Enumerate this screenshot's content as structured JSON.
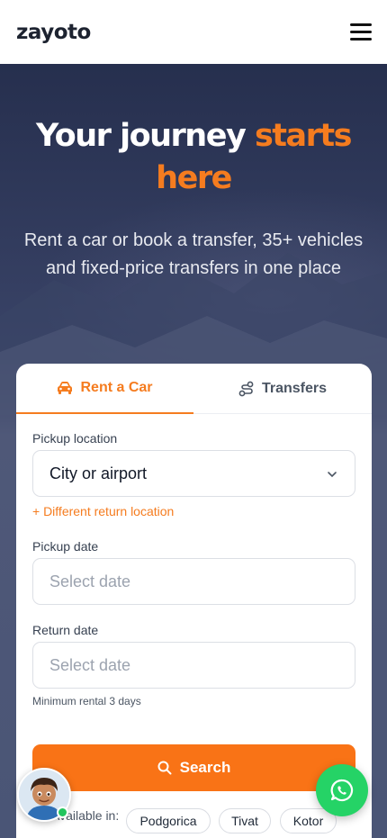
{
  "header": {
    "logo": "zayoto",
    "menu_icon": "hamburger-menu-icon"
  },
  "hero": {
    "title_main": "Your journey ",
    "title_accent": "starts here",
    "subtitle": "Rent a car or book a transfer, 35+ vehicles and fixed-price transfers in one place"
  },
  "booking": {
    "tabs": [
      {
        "label": "Rent a Car",
        "icon": "car-icon",
        "active": true
      },
      {
        "label": "Transfers",
        "icon": "route-icon",
        "active": false
      }
    ],
    "pickup_location": {
      "label": "Pickup location",
      "value": "City or airport"
    },
    "return_location_link": "+ Different return location",
    "pickup_date": {
      "label": "Pickup date",
      "placeholder": "Select date"
    },
    "return_date": {
      "label": "Return date",
      "placeholder": "Select date"
    },
    "minimum_note": "Minimum rental 3 days",
    "search_label": "Search",
    "available_label": "Available in:",
    "locations": [
      "Podgorica",
      "Tivat",
      "Kotor"
    ]
  },
  "colors": {
    "accent": "#f57c1f",
    "button": "#f97316",
    "whatsapp": "#25d366",
    "hero_bg": "#2b3759"
  }
}
